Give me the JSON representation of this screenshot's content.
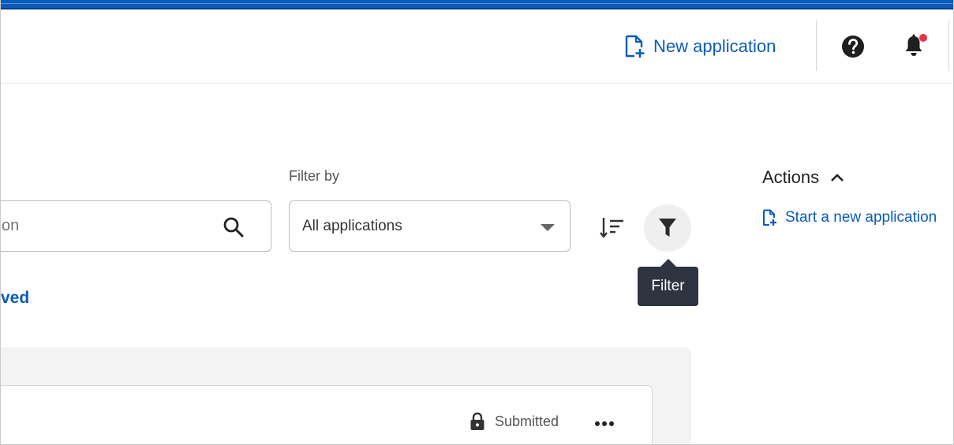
{
  "header": {
    "new_application_label": "New application",
    "icons": {
      "new_application": "file-plus-icon",
      "help": "help-circle-icon",
      "notifications": "bell-icon"
    },
    "notification_indicator_color": "#e8334a"
  },
  "toolbar": {
    "search_placeholder_visible": "on",
    "filter_by_label": "Filter by",
    "filter_select_value": "All applications",
    "sort_icon": "sort-descending-icon",
    "filter_icon": "funnel-icon",
    "filter_tooltip": "Filter"
  },
  "tabs": {
    "partial_tab_text": "ved"
  },
  "list": {
    "items": [
      {
        "status": "Submitted",
        "status_icon": "lock-icon",
        "menu_icon": "more-horizontal-icon"
      }
    ]
  },
  "actions": {
    "title": "Actions",
    "toggle_icon": "chevron-up-icon",
    "start_new_label": "Start a new application",
    "start_new_icon": "file-plus-icon"
  },
  "colors": {
    "brand": "#0a5cb8",
    "tooltip_bg": "#2e3440",
    "panel_bg": "#f3f3f3"
  }
}
